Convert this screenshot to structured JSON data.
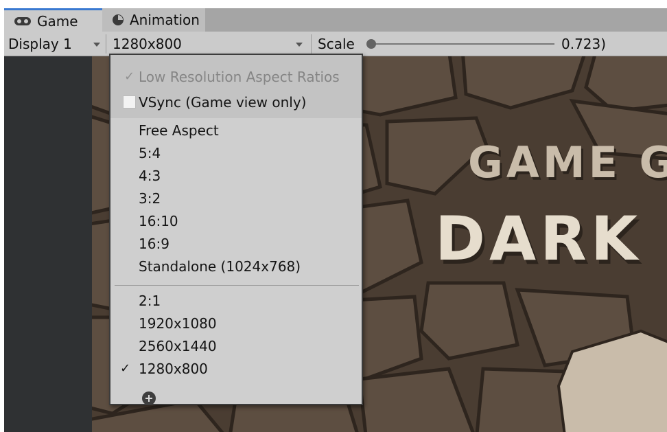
{
  "tabs": [
    {
      "label": "Game",
      "icon": "gamepad-icon",
      "active": true
    },
    {
      "label": "Animation",
      "icon": "animation-clock-icon",
      "active": false
    }
  ],
  "toolbar": {
    "display_label": "Display 1",
    "resolution_label": "1280x800",
    "scale_label": "Scale",
    "scale_value": "0.723)",
    "scale_fraction": 0.0
  },
  "dropdown": {
    "low_res_label": "Low Resolution Aspect Ratios",
    "low_res_checked": true,
    "low_res_enabled": false,
    "vsync_label": "VSync (Game view only)",
    "vsync_checked": false,
    "builtin_options": [
      "Free Aspect",
      "5:4",
      "4:3",
      "3:2",
      "16:10",
      "16:9",
      "Standalone (1024x768)"
    ],
    "custom_options": [
      "2:1",
      "1920x1080",
      "2560x1440",
      "1280x800"
    ],
    "selected": "1280x800",
    "checkmark": "✓",
    "add_icon": "plus-circle-icon"
  },
  "game": {
    "title_line1": "GAME G",
    "title_line2": "DARK"
  },
  "colors": {
    "tab_active_accent": "#3a79d1",
    "game_background": "#4b3e33",
    "title_color": "#e6ddcd"
  }
}
